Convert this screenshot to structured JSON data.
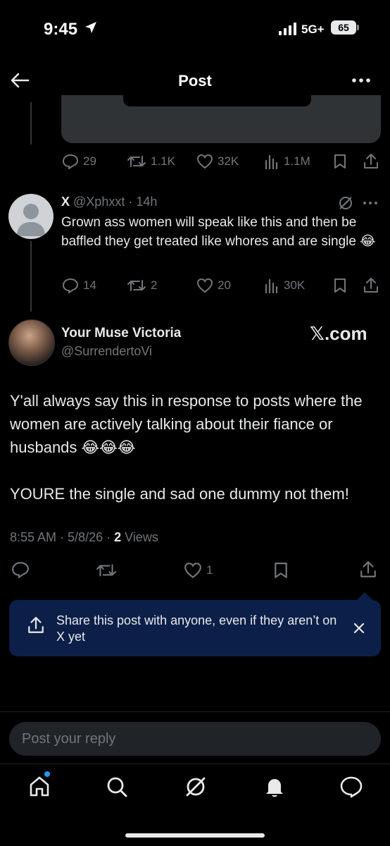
{
  "status_bar": {
    "time": "9:45",
    "network": "5G+",
    "battery": "65"
  },
  "header": {
    "title": "Post"
  },
  "quoted_actions": {
    "replies": "29",
    "reposts": "1.1K",
    "likes": "32K",
    "views": "1.1M"
  },
  "reply": {
    "name": "X",
    "handle": "@Xphxxt",
    "time": "14h",
    "text": "Grown ass women will speak like this and then be baffled they get treated like whores and are single 😂",
    "replies": "14",
    "reposts": "2",
    "likes": "20",
    "views": "30K"
  },
  "post": {
    "author_name": "Your Muse Victoria",
    "author_handle": "@SurrendertoVi",
    "badge_text": "𝕏.com",
    "text": "Y'all always say this in response to posts where the women are actively talking about their fiance or husbands 😂😂😂\n\nYOURE the single and sad one dummy not them!",
    "time": "8:55 AM",
    "date": "5/8/26",
    "views_count": "2",
    "views_label": "Views",
    "likes": "1"
  },
  "share_banner": {
    "text": "Share this post with anyone, even if they aren’t on X yet"
  },
  "reply_box": {
    "placeholder": "Post your reply"
  },
  "colors": {
    "accent": "#1d9bf0",
    "muted": "#71767b",
    "banner": "#0c1f48"
  }
}
